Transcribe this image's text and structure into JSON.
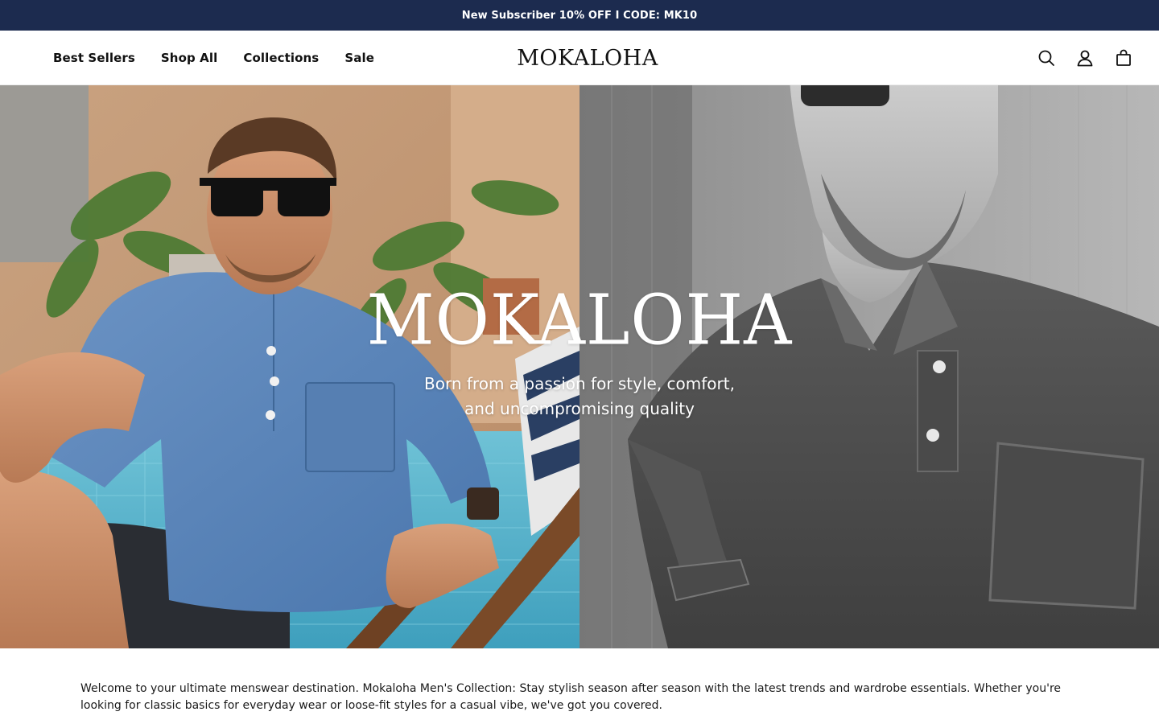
{
  "announcement": {
    "text": "New Subscriber 10% OFF I CODE: MK10"
  },
  "header": {
    "nav": [
      {
        "label": "Best Sellers"
      },
      {
        "label": "Shop All"
      },
      {
        "label": "Collections"
      },
      {
        "label": "Sale"
      }
    ],
    "logo": "MOKALOHA",
    "icons": [
      "search-icon",
      "account-icon",
      "cart-icon"
    ]
  },
  "hero": {
    "title": "MOKALOHA",
    "tagline": "Born from a passion for style, comfort, and uncompromising quality"
  },
  "intro": {
    "text": "Welcome to your ultimate menswear destination. Mokaloha Men's Collection: Stay stylish season after season with the latest trends and wardrobe essentials. Whether you're looking for classic basics for everyday wear or loose-fit styles for a casual vibe, we've got you covered."
  },
  "colors": {
    "announcement_bg": "#1c2b4f",
    "text": "#111111"
  }
}
